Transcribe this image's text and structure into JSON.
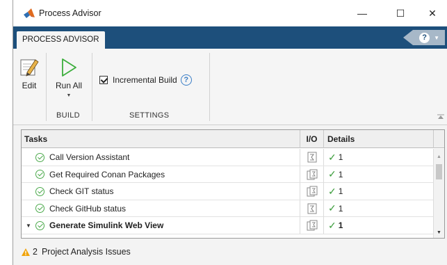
{
  "window": {
    "title": "Process Advisor",
    "icon": "matlab-logo-icon",
    "controls": {
      "minimize": "—",
      "maximize": "☐",
      "close": "✕"
    }
  },
  "tabs": [
    {
      "label": "PROCESS ADVISOR",
      "active": true
    }
  ],
  "help": {
    "icon": "question-icon",
    "symbol": "?",
    "caret": "▼"
  },
  "toolstrip": {
    "edit": {
      "label": "Edit",
      "icon": "edit-pencil-icon"
    },
    "run_all": {
      "label": "Run All",
      "icon": "play-icon",
      "caret": "▼"
    },
    "incremental_build": {
      "label": "Incremental Build",
      "checked": true,
      "help": "?"
    },
    "groups": {
      "build": "BUILD",
      "settings": "SETTINGS"
    }
  },
  "table": {
    "columns": {
      "tasks": "Tasks",
      "io": "I/O",
      "details": "Details"
    },
    "rows": [
      {
        "task": "Call Version Assistant",
        "status": "passed",
        "details_count": "1",
        "expandable": false,
        "bold": false
      },
      {
        "task": "Get Required Conan Packages",
        "status": "passed",
        "details_count": "1",
        "expandable": false,
        "bold": false
      },
      {
        "task": "Check GIT status",
        "status": "passed",
        "details_count": "1",
        "expandable": false,
        "bold": false
      },
      {
        "task": "Check GitHub status",
        "status": "passed",
        "details_count": "1",
        "expandable": false,
        "bold": false
      },
      {
        "task": "Generate Simulink Web View",
        "status": "passed",
        "details_count": "1",
        "expandable": true,
        "bold": true
      }
    ]
  },
  "footer": {
    "issue_count": "2",
    "issue_label": "Project Analysis Issues",
    "icon": "warning-icon"
  },
  "colors": {
    "tabstrip": "#1d4f7b",
    "success": "#4caa4c",
    "warning": "#f0a30a"
  }
}
